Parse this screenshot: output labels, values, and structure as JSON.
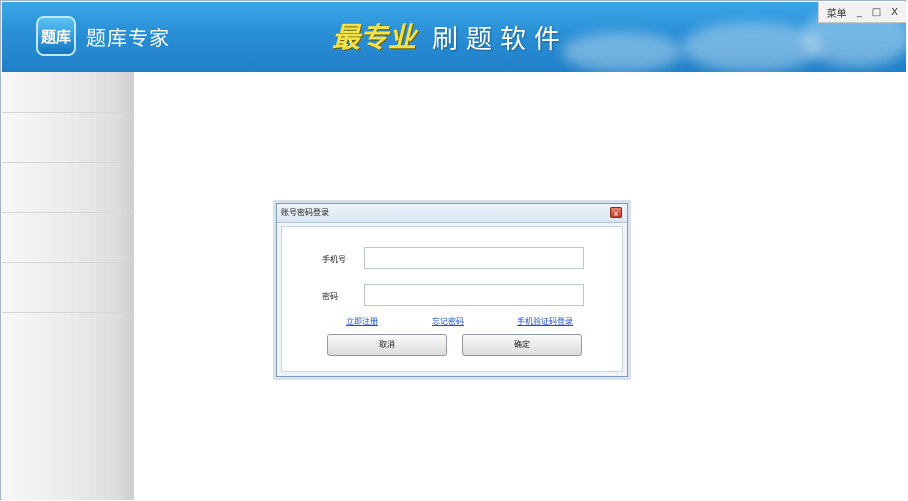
{
  "header": {
    "logo_icon": "题库",
    "app_title": "题库专家",
    "slogan_brand": "最专业",
    "slogan": "刷题软件"
  },
  "window_controls": {
    "menu": "菜单",
    "minimize": "_",
    "maximize": "□",
    "close": "X"
  },
  "dialog": {
    "title": "账号密码登录",
    "close_icon": "x",
    "phone_label": "手机号",
    "phone_value": "",
    "password_label": "密码",
    "password_value": "",
    "links": {
      "register": "立即注册",
      "forgot": "忘记密码",
      "sms_login": "手机验证码登录"
    },
    "buttons": {
      "cancel": "取消",
      "ok": "确定"
    }
  },
  "colors": {
    "header_blue": "#2a8fd6",
    "link_blue": "#1a4fd6",
    "brand_yellow": "#f3e24a"
  }
}
